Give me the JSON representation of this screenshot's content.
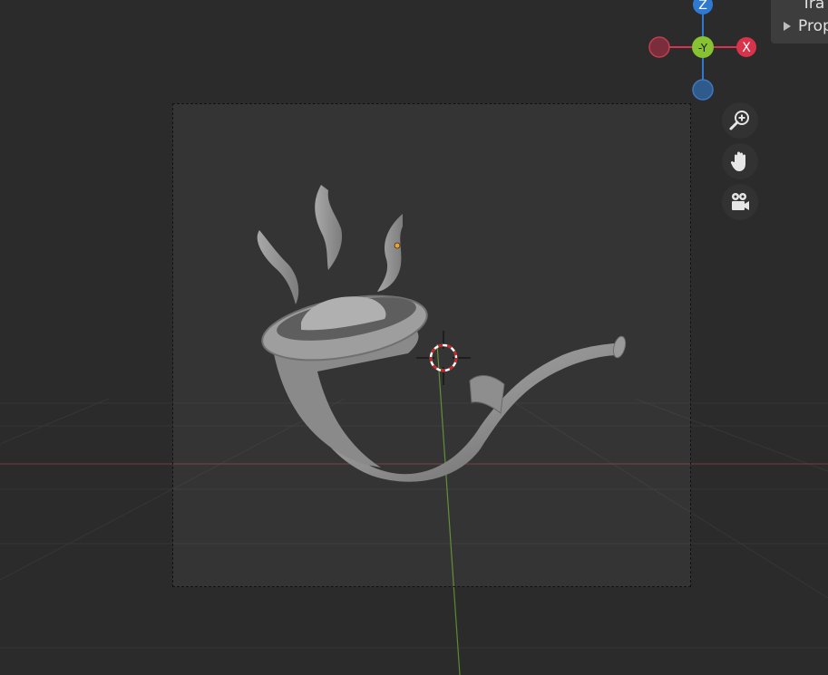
{
  "gizmo": {
    "z_label": "Z",
    "neg_y_label": "-Y",
    "x_label": "X",
    "colors": {
      "x": "#d8334a",
      "y": "#86c232",
      "z": "#2f79d0"
    }
  },
  "nav_tools": {
    "zoom_icon": "zoom-magnifier-icon",
    "pan_icon": "hand-icon",
    "camera_icon": "movie-camera-icon"
  },
  "side_panel": {
    "item_transform": "Tra",
    "item_properties": "Prop"
  }
}
